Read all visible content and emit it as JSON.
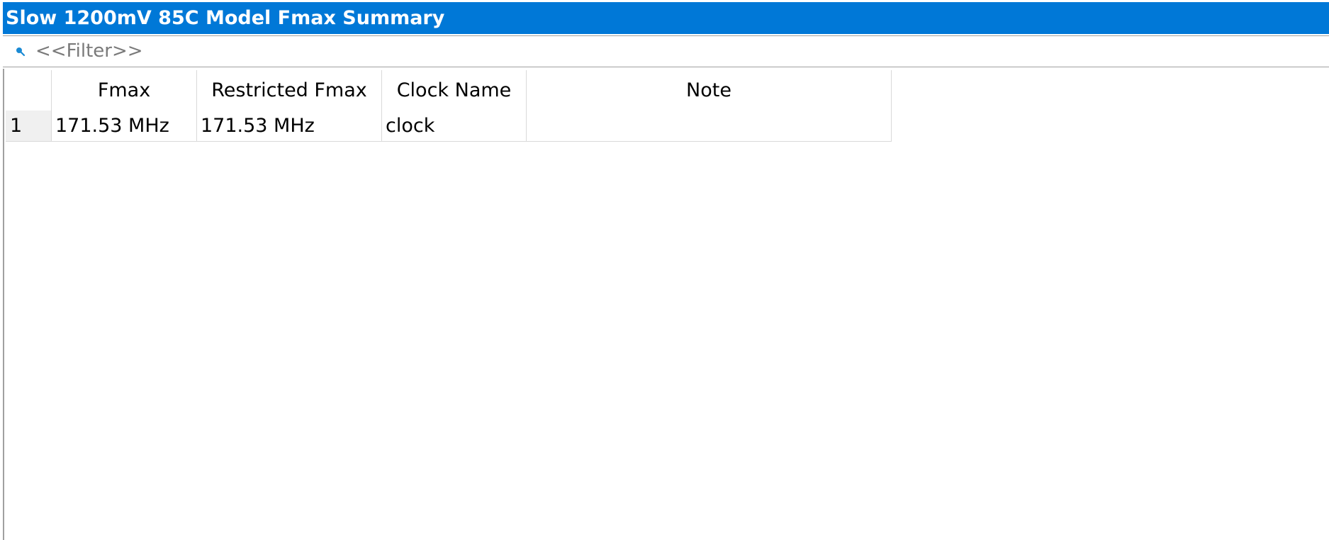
{
  "panel": {
    "title": "Slow 1200mV 85C Model Fmax Summary"
  },
  "filter": {
    "placeholder": "<<Filter>>",
    "icon": "search-icon",
    "icon_color": "#1a8ad4"
  },
  "table": {
    "columns": [
      "",
      "Fmax",
      "Restricted Fmax",
      "Clock Name",
      "Note"
    ],
    "rows": [
      {
        "index": "1",
        "fmax": "171.53 MHz",
        "restricted_fmax": "171.53 MHz",
        "clock_name": "clock",
        "note": ""
      }
    ]
  },
  "colors": {
    "title_bar": "#0078d7",
    "title_text": "#ffffff",
    "row_header_bg": "#f0f0f0"
  }
}
